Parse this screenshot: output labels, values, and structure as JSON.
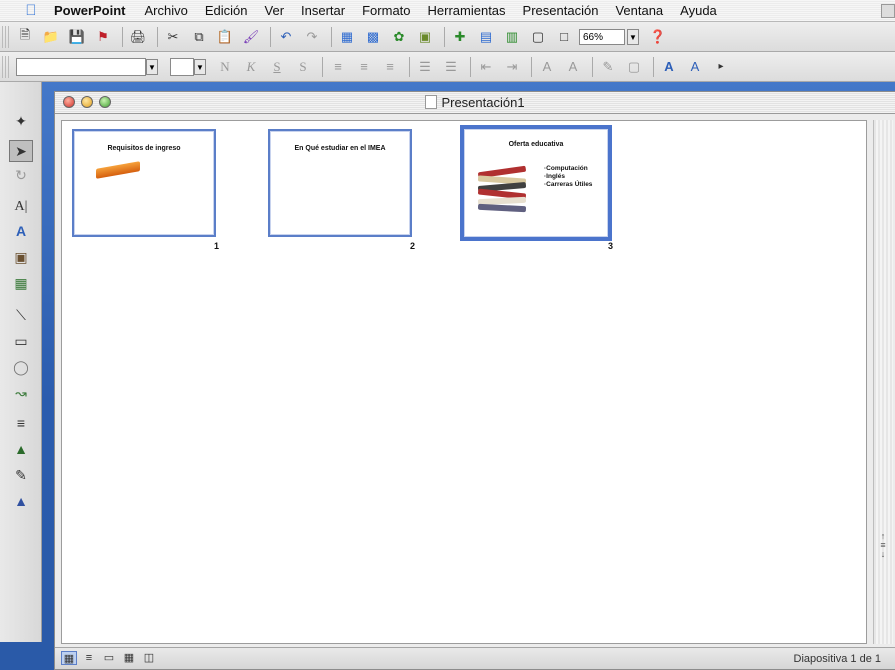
{
  "menubar": {
    "app_name": "PowerPoint",
    "items": [
      "Archivo",
      "Edición",
      "Ver",
      "Insertar",
      "Formato",
      "Herramientas",
      "Presentación",
      "Ventana",
      "Ayuda"
    ]
  },
  "toolbar": {
    "zoom": "66%"
  },
  "window": {
    "title": "Presentación1"
  },
  "slides": [
    {
      "number": "1",
      "title": "Requisitos de ingreso",
      "bullets": []
    },
    {
      "number": "2",
      "title": "En Qué estudiar en el IMEA",
      "bullets": []
    },
    {
      "number": "3",
      "title": "Oferta educativa",
      "bullets": [
        "Computación",
        "Inglés",
        "Carreras Útiles"
      ]
    }
  ],
  "status": {
    "text": "Diapositiva 1 de 1"
  },
  "colors": {
    "selection_border": "#4b74cc",
    "desktop": "#2f63b8"
  }
}
